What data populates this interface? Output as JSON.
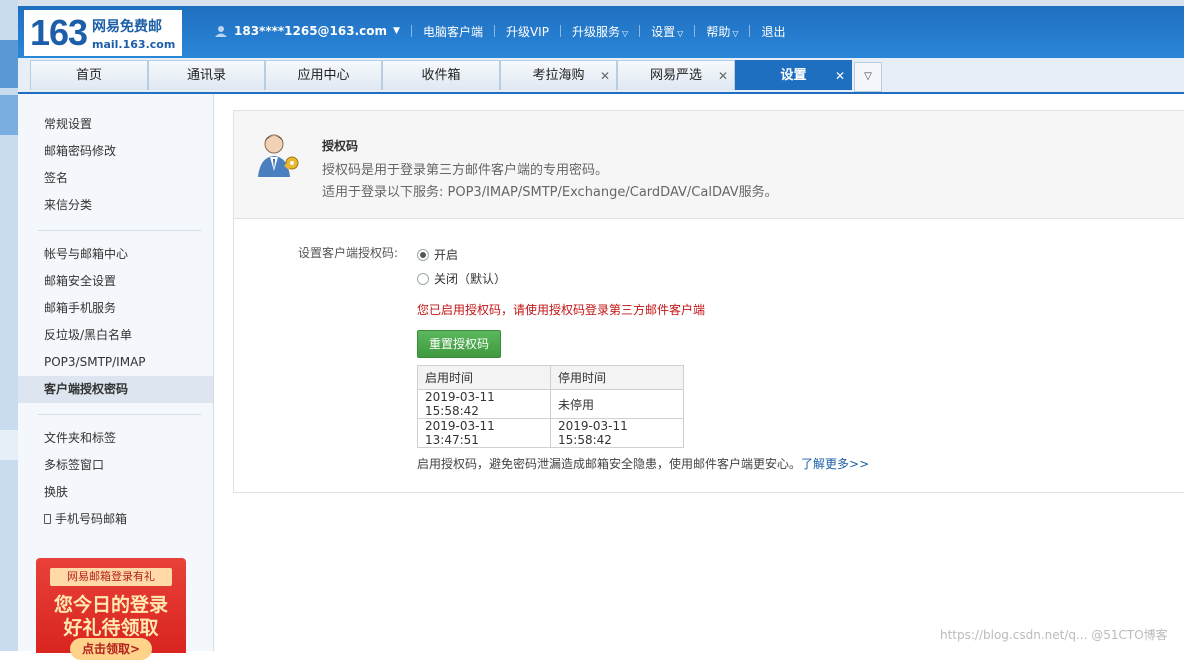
{
  "logo": {
    "number": "163",
    "cn": "网易免费邮",
    "domain": "mail.163.com"
  },
  "topnav": {
    "account": "183****1265@163.com",
    "items": [
      "电脑客户端",
      "升级VIP",
      "升级服务",
      "设置",
      "帮助",
      "退出"
    ]
  },
  "tabs": [
    "首页",
    "通讯录",
    "应用中心",
    "收件箱",
    "考拉海购",
    "网易严选",
    "设置"
  ],
  "sidebar": {
    "group1": [
      "常规设置",
      "邮箱密码修改",
      "签名",
      "来信分类"
    ],
    "group2": [
      "帐号与邮箱中心",
      "邮箱安全设置",
      "邮箱手机服务",
      "反垃圾/黑白名单",
      "POP3/SMTP/IMAP",
      "客户端授权密码"
    ],
    "group3": [
      "文件夹和标签",
      "多标签窗口",
      "换肤",
      "手机号码邮箱"
    ]
  },
  "promo": {
    "ribbon": "网易邮箱登录有礼",
    "line1": "您今日的登录",
    "line2": "好礼待领取",
    "button": "点击领取>"
  },
  "panel": {
    "title": "授权码",
    "desc1": "授权码是用于登录第三方邮件客户端的专用密码。",
    "desc2": "适用于登录以下服务: POP3/IMAP/SMTP/Exchange/CardDAV/CalDAV服务。",
    "label": "设置客户端授权码:",
    "option_on": "开启",
    "option_off": "关闭（默认）",
    "notice": "您已启用授权码，请使用授权码登录第三方邮件客户端",
    "reset_button": "重置授权码",
    "log_headers": [
      "启用时间",
      "停用时间"
    ],
    "log_rows": [
      [
        "2019-03-11 15:58:42",
        "未停用"
      ],
      [
        "2019-03-11 13:47:51",
        "2019-03-11 15:58:42"
      ]
    ],
    "footer_text": "启用授权码，避免密码泄漏造成邮箱安全隐患，使用邮件客户端更安心。",
    "footer_link": "了解更多>>"
  },
  "watermark": "https://blog.csdn.net/q... @51CTO博客"
}
